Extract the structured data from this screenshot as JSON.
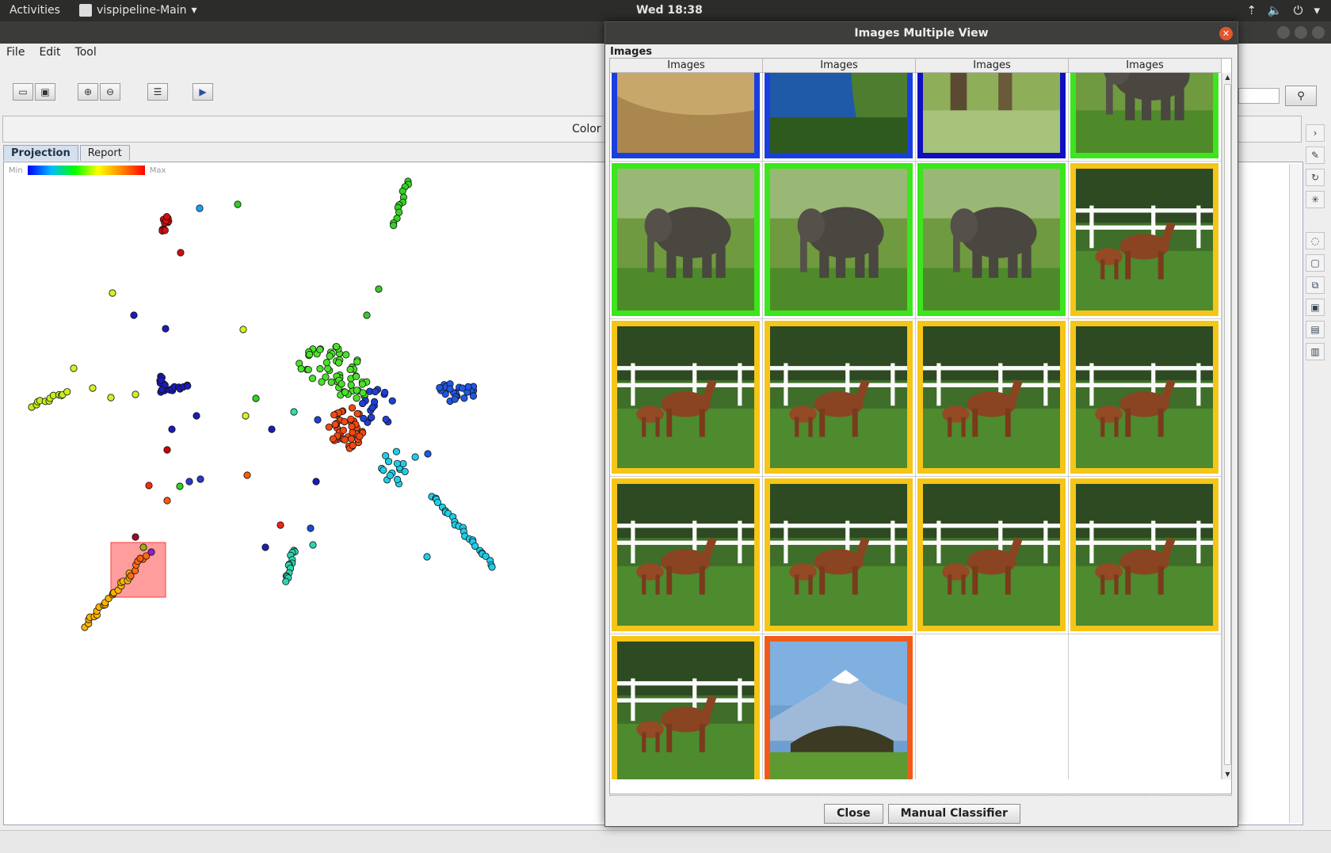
{
  "topbar": {
    "activities": "Activities",
    "app_name": "vispipeline-Main",
    "clock": "Wed 18:38"
  },
  "menu": {
    "file": "File",
    "edit": "Edit",
    "tool": "Tool"
  },
  "color_panel": {
    "label": "Color"
  },
  "tabs": [
    {
      "label": "Projection"
    },
    {
      "label": "Report"
    }
  ],
  "legend": {
    "min": "Min",
    "max": "Max"
  },
  "dialog": {
    "title": "Images Multiple View",
    "panel_label": "Images",
    "column_headers": [
      "Images",
      "Images",
      "Images",
      "Images"
    ],
    "close_button": "Close",
    "manual_classifier_button": "Manual Classifier",
    "cells": [
      {
        "subject": "beach",
        "border": "#1a3fe0"
      },
      {
        "subject": "sea",
        "border": "#1a3fe0"
      },
      {
        "subject": "tree",
        "border": "#1010c0"
      },
      {
        "subject": "elephant",
        "border": "#3ce51e"
      },
      {
        "subject": "elephant",
        "border": "#3ce51e"
      },
      {
        "subject": "elephant",
        "border": "#3ce51e"
      },
      {
        "subject": "elephant",
        "border": "#3ce51e"
      },
      {
        "subject": "horse",
        "border": "#f5c518"
      },
      {
        "subject": "horse",
        "border": "#f5c518"
      },
      {
        "subject": "horse",
        "border": "#f5c518"
      },
      {
        "subject": "horse",
        "border": "#f5c518"
      },
      {
        "subject": "horse",
        "border": "#f5c518"
      },
      {
        "subject": "horse",
        "border": "#f5c518"
      },
      {
        "subject": "horse",
        "border": "#f5c518"
      },
      {
        "subject": "horse",
        "border": "#f5c518"
      },
      {
        "subject": "horse",
        "border": "#f5c518"
      },
      {
        "subject": "horse",
        "border": "#f5c518"
      },
      {
        "subject": "mountain",
        "border": "#f25a1a"
      }
    ]
  },
  "colors": {
    "accent_close": "#e2572c",
    "selection": "#ff7777"
  }
}
